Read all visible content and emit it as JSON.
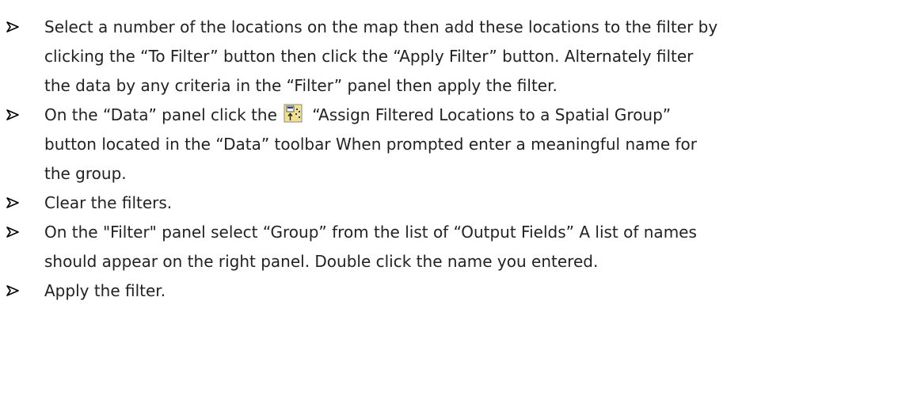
{
  "instructions": [
    {
      "lines": [
        "Select a number of the locations on the map then add these locations to the filter by",
        "clicking the “To Filter” button then click the “Apply Filter” button.  Alternately  filter",
        "the data by any criteria in the “Filter” panel then  apply the filter."
      ]
    },
    {
      "line1_before": "On the “Data” panel click the",
      "icon": "assign-spatial-group-icon",
      "line1_after": " “Assign Filtered Locations to a Spatial Group”",
      "lines": [
        "button located in the “Data” toolbar  When prompted enter a meaningful name for",
        "the group."
      ]
    },
    {
      "lines": [
        "Clear the filters."
      ]
    },
    {
      "lines": [
        "On the \"Filter\" panel select “Group” from the list of “Output Fields” A list of names",
        "should appear on the right panel. Double click the name you entered."
      ]
    },
    {
      "lines": [
        "Apply the filter."
      ]
    }
  ],
  "colors": {
    "text": "#222222",
    "bullet": "#000000",
    "icon_body": "#f3e08a",
    "icon_border": "#8a8a8a",
    "icon_dots": "#1b3fa8"
  }
}
